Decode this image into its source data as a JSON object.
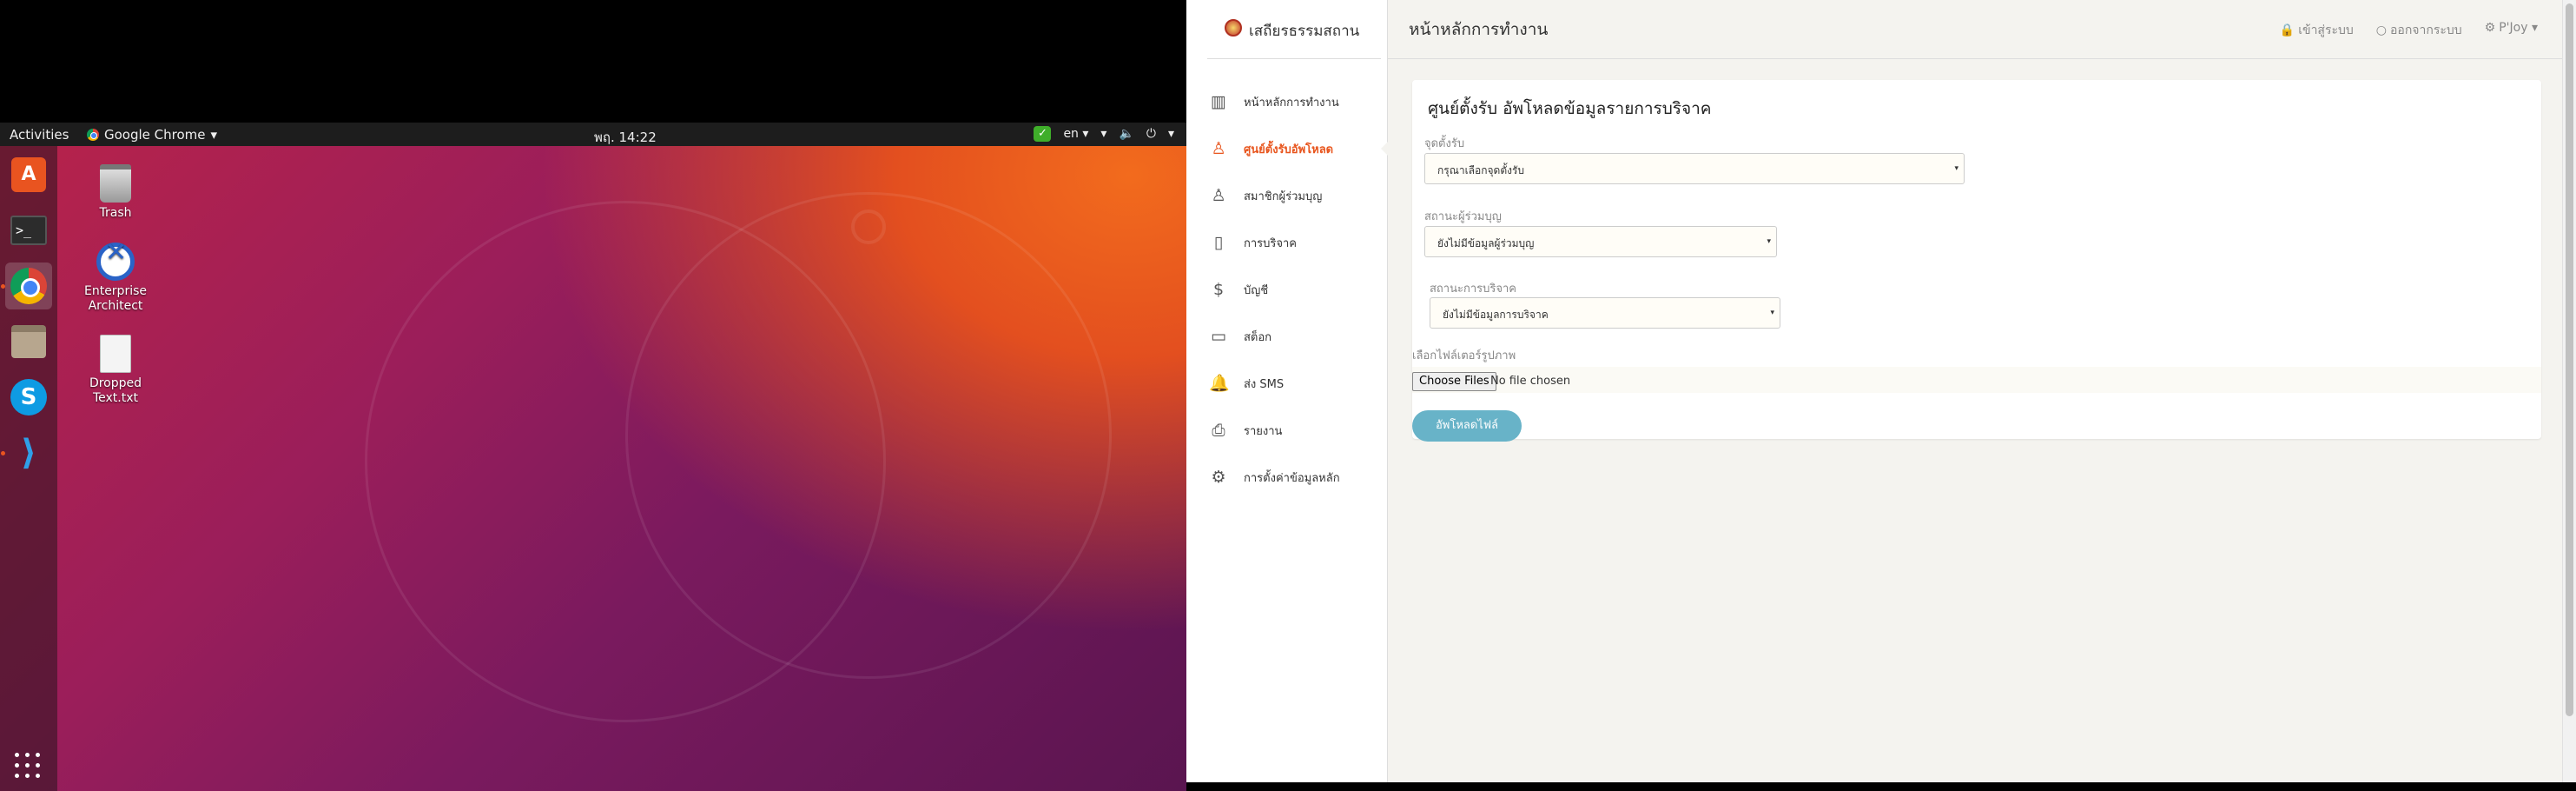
{
  "ubuntu": {
    "topbar": {
      "activities": "Activities",
      "app_menu": "Google Chrome",
      "app_menu_caret": "▾",
      "clock": "พฤ. 14:22",
      "lang": "en",
      "lang_caret": "▾",
      "wifi_icon": "▾",
      "volume_icon": "🔈",
      "power_icon": "⏻",
      "menu_caret": "▾"
    },
    "dock": {
      "items": [
        {
          "name": "ubuntu-software",
          "glyph": "A"
        },
        {
          "name": "terminal",
          "glyph": ">_"
        },
        {
          "name": "google-chrome",
          "glyph": ""
        },
        {
          "name": "files",
          "glyph": ""
        },
        {
          "name": "skype",
          "glyph": "S"
        },
        {
          "name": "vscode",
          "glyph": "⟩"
        }
      ]
    },
    "desktop_icons": {
      "trash": "Trash",
      "enterprise_architect": "Enterprise Architect",
      "dropped_text": "Dropped Text.txt"
    }
  },
  "app": {
    "logo_text": "เสถียรธรรมสถาน",
    "page_title": "หน้าหลักการทำงาน",
    "header_links": {
      "login": "เข้าสู่ระบบ",
      "logout": "ออกจากระบบ",
      "user": "P'Joy",
      "user_caret": "▾",
      "login_icon": "🔒",
      "logout_icon": "○",
      "user_icon": "⚙"
    },
    "nav": [
      {
        "label": "หน้าหลักการทำงาน",
        "icon": "▥"
      },
      {
        "label": "ศูนย์ตั้งรับอัพโหลด",
        "icon": "♙"
      },
      {
        "label": "สมาชิกผู้ร่วมบุญ",
        "icon": "♙"
      },
      {
        "label": "การบริจาค",
        "icon": "▯"
      },
      {
        "label": "บัญชี",
        "icon": "$"
      },
      {
        "label": "สต็อก",
        "icon": "▭"
      },
      {
        "label": "ส่ง SMS",
        "icon": "🔔"
      },
      {
        "label": "รายงาน",
        "icon": "⎙"
      },
      {
        "label": "การตั้งค่าข้อมูลหลัก",
        "icon": "⚙"
      }
    ],
    "form": {
      "title": "ศูนย์ตั้งรับ อัพโหลดข้อมูลรายการบริจาค",
      "receive_point_label": "จุดตั้งรับ",
      "receive_point_value": "กรุณาเลือกจุดตั้งรับ",
      "donor_status_label": "สถานะผู้ร่วมบุญ",
      "donor_status_value": "ยังไม่มีข้อมูลผู้ร่วมบุญ",
      "donation_status_label": "สถานะการบริจาค",
      "donation_status_value": "ยังไม่มีข้อมูลการบริจาค",
      "file_label": "เลือกไฟล์เตอร์รูปภาพ",
      "file_button": "Choose Files",
      "file_status": "No file chosen",
      "upload_button": "อัพโหลดไฟล์",
      "caret": "▾"
    }
  }
}
